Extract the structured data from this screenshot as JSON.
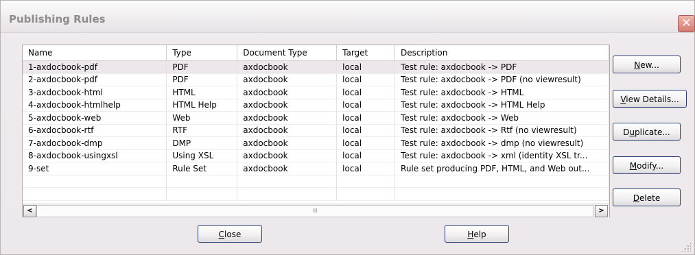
{
  "window": {
    "title": "Publishing Rules",
    "close_glyph": "✕"
  },
  "table": {
    "columns": [
      "Name",
      "Type",
      "Document Type",
      "Target",
      "Description"
    ],
    "selected_index": 0,
    "rows": [
      {
        "name": "1-axdocbook-pdf",
        "type": "PDF",
        "doctype": "axdocbook",
        "target": "local",
        "desc": "Test rule:  axdocbook -> PDF"
      },
      {
        "name": "2-axdocbook-pdf",
        "type": "PDF",
        "doctype": "axdocbook",
        "target": "local",
        "desc": "Test rule:  axdocbook -> PDF (no viewresult)"
      },
      {
        "name": "3-axdocbook-html",
        "type": "HTML",
        "doctype": "axdocbook",
        "target": "local",
        "desc": "Test rule:  axdocbook -> HTML"
      },
      {
        "name": "4-axdocbook-htmlhelp",
        "type": "HTML Help",
        "doctype": "axdocbook",
        "target": "local",
        "desc": "Test rule:  axdocbook -> HTML Help"
      },
      {
        "name": "5-axdocbook-web",
        "type": "Web",
        "doctype": "axdocbook",
        "target": "local",
        "desc": "Test rule:  axdocbook -> Web"
      },
      {
        "name": "6-axdocbook-rtf",
        "type": "RTF",
        "doctype": "axdocbook",
        "target": "local",
        "desc": "Test rule:  axdocbook -> Rtf (no viewresult)"
      },
      {
        "name": "7-axdocbook-dmp",
        "type": "DMP",
        "doctype": "axdocbook",
        "target": "local",
        "desc": "Test rule:  axdocbook -> dmp (no viewresult)"
      },
      {
        "name": "8-axdocbook-usingxsl",
        "type": "Using XSL",
        "doctype": "axdocbook",
        "target": "local",
        "desc": "Test rule:  axdocbook -> xml (identity XSL tr..."
      },
      {
        "name": "9-set",
        "type": "Rule Set",
        "doctype": "axdocbook",
        "target": "local",
        "desc": "Rule set producing PDF, HTML, and Web out..."
      },
      {
        "name": "",
        "type": "",
        "doctype": "",
        "target": "",
        "desc": ""
      },
      {
        "name": "",
        "type": "",
        "doctype": "",
        "target": "",
        "desc": ""
      }
    ]
  },
  "scrollbar": {
    "left_arrow": "<",
    "right_arrow": ">",
    "thumb_grip": "III"
  },
  "buttons": {
    "new": {
      "mnemonic": "N",
      "rest": "ew..."
    },
    "view_details": {
      "mnemonic": "V",
      "rest": "iew Details..."
    },
    "duplicate": {
      "pre": "D",
      "mnemonic": "u",
      "rest": "plicate..."
    },
    "modify": {
      "mnemonic": "M",
      "rest": "odify..."
    },
    "delete": {
      "mnemonic": "D",
      "rest": "elete"
    },
    "close": {
      "mnemonic": "C",
      "rest": "lose"
    },
    "help": {
      "mnemonic": "H",
      "rest": "elp"
    }
  }
}
